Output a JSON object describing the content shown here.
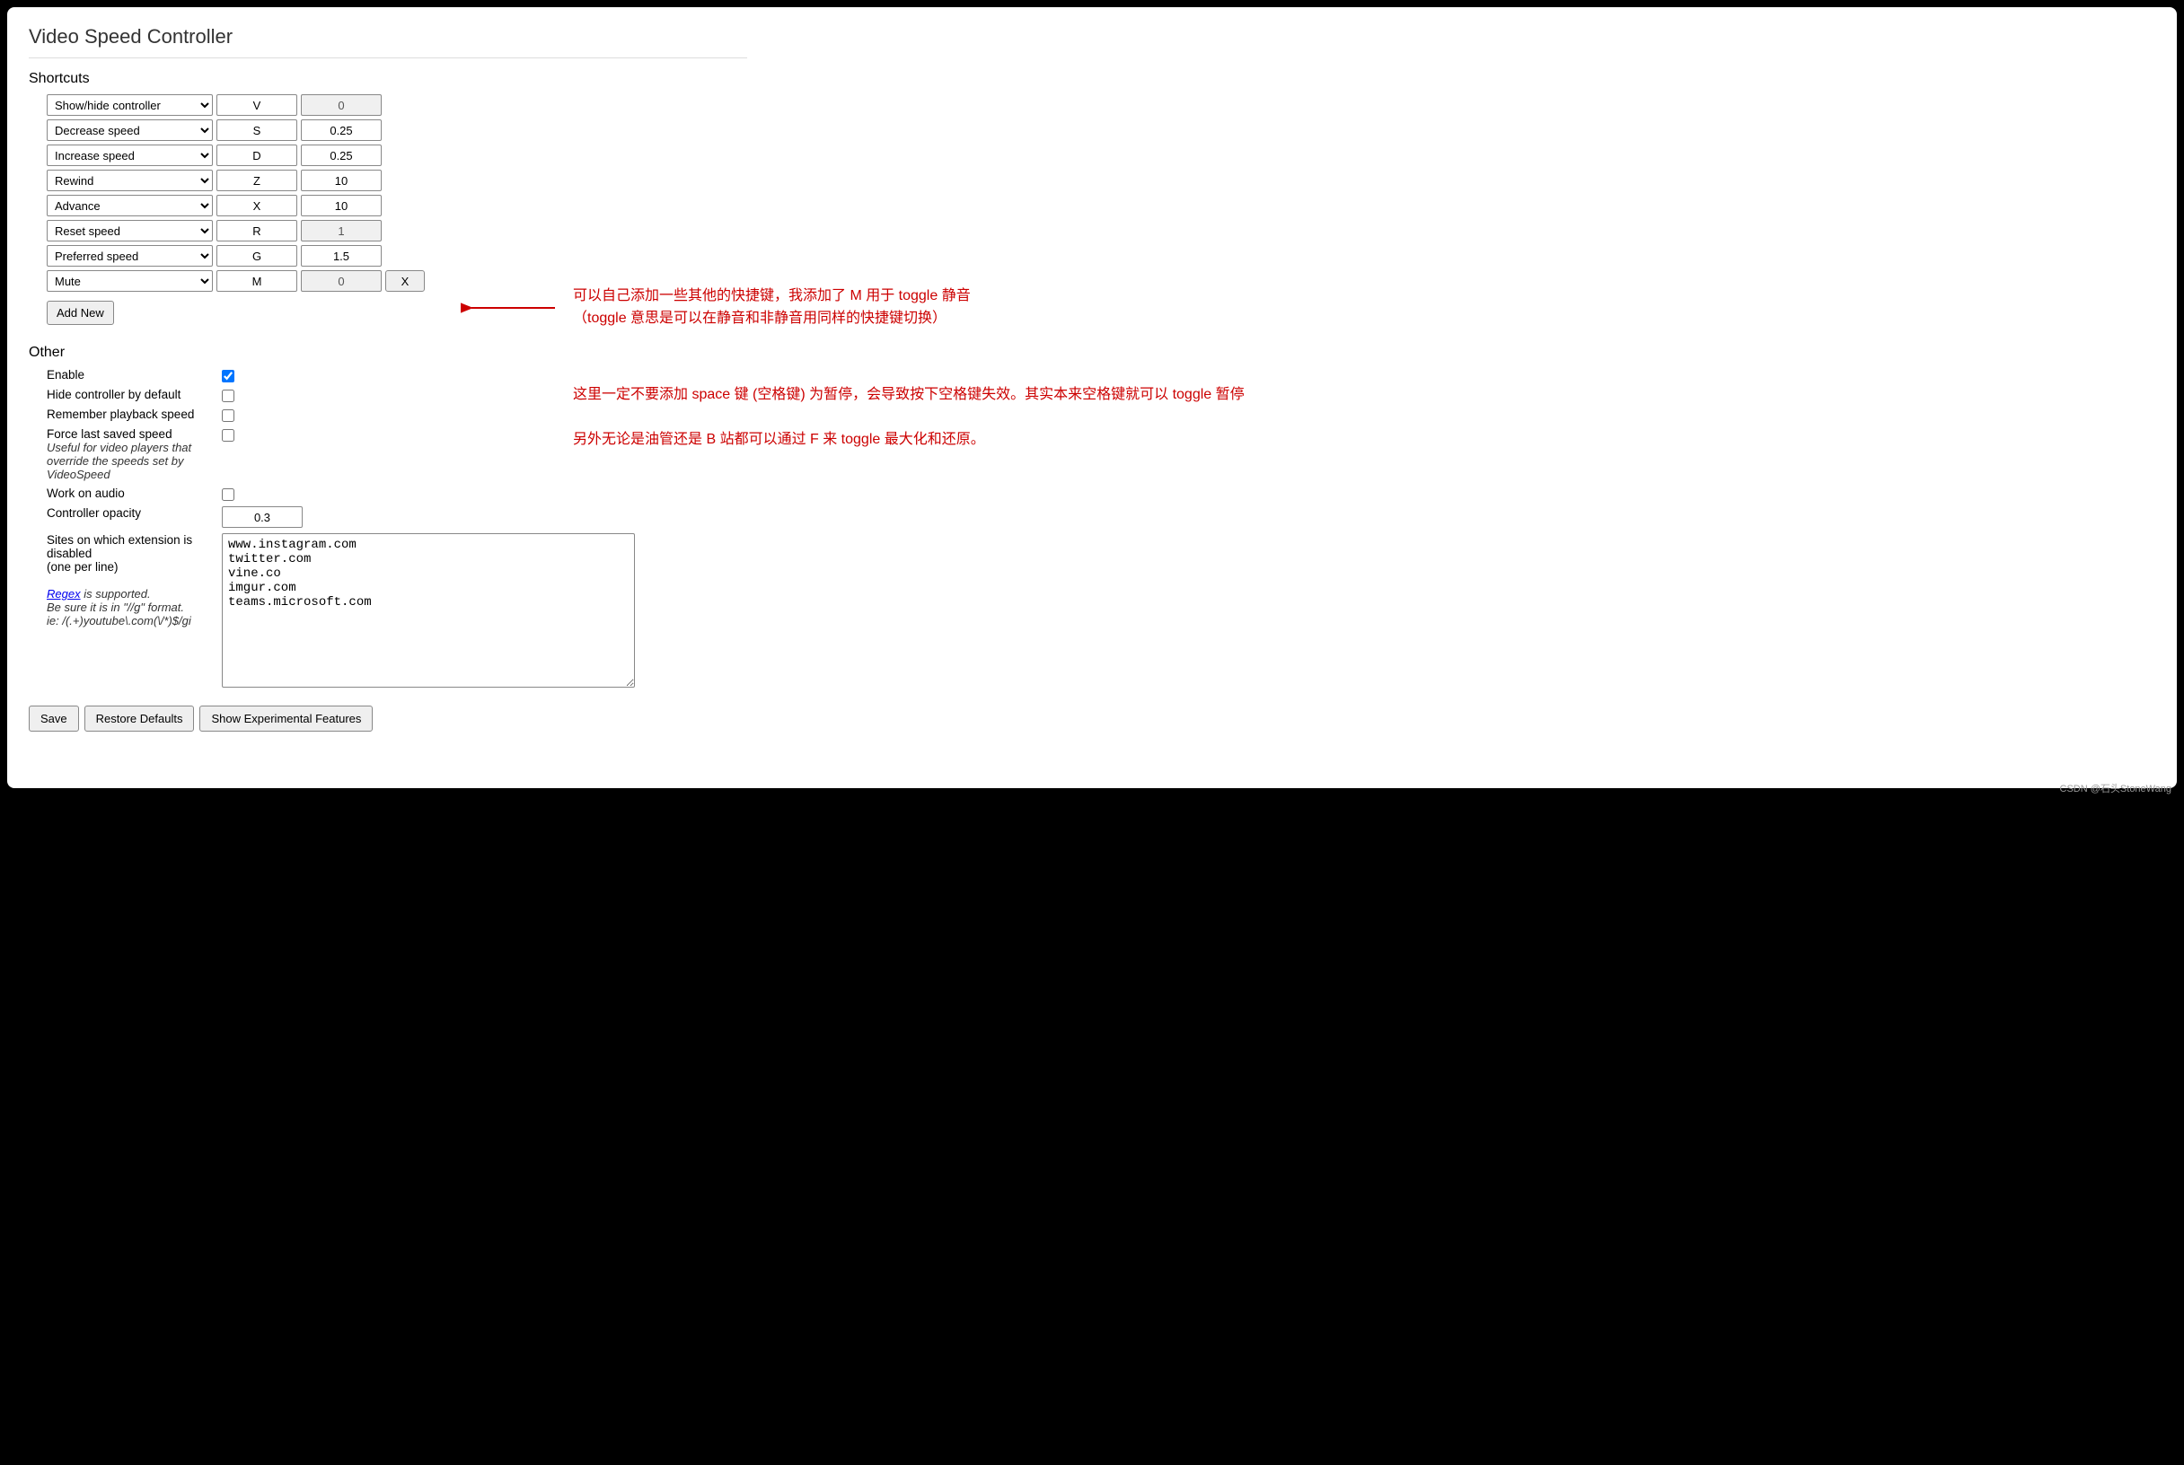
{
  "title": "Video Speed Controller",
  "sections": {
    "shortcuts_heading": "Shortcuts",
    "other_heading": "Other"
  },
  "shortcuts": [
    {
      "action": "Show/hide controller",
      "key": "V",
      "value": "0",
      "readonly": true,
      "removable": false
    },
    {
      "action": "Decrease speed",
      "key": "S",
      "value": "0.25",
      "readonly": false,
      "removable": false
    },
    {
      "action": "Increase speed",
      "key": "D",
      "value": "0.25",
      "readonly": false,
      "removable": false
    },
    {
      "action": "Rewind",
      "key": "Z",
      "value": "10",
      "readonly": false,
      "removable": false
    },
    {
      "action": "Advance",
      "key": "X",
      "value": "10",
      "readonly": false,
      "removable": false
    },
    {
      "action": "Reset speed",
      "key": "R",
      "value": "1",
      "readonly": true,
      "removable": false
    },
    {
      "action": "Preferred speed",
      "key": "G",
      "value": "1.5",
      "readonly": false,
      "removable": false
    },
    {
      "action": "Mute",
      "key": "M",
      "value": "0",
      "readonly": true,
      "removable": true
    }
  ],
  "buttons": {
    "add_new": "Add New",
    "remove": "X",
    "save": "Save",
    "restore": "Restore Defaults",
    "experimental": "Show Experimental Features"
  },
  "other": {
    "enable_label": "Enable",
    "enable_checked": true,
    "hide_label": "Hide controller by default",
    "hide_checked": false,
    "remember_label": "Remember playback speed",
    "remember_checked": false,
    "force_label": "Force last saved speed",
    "force_hint": "Useful for video players that override the speeds set by VideoSpeed",
    "force_checked": false,
    "audio_label": "Work on audio",
    "audio_checked": false,
    "opacity_label": "Controller opacity",
    "opacity_value": "0.3",
    "sites_label": "Sites on which extension is disabled",
    "sites_hint": "(one per line)",
    "regex_link": "Regex",
    "regex_hint1": " is supported.",
    "regex_hint2": "Be sure it is in \"//g\" format.",
    "regex_hint3": "ie: /(.+)youtube\\.com(\\/*)$/gi",
    "sites_value": "www.instagram.com\ntwitter.com\nvine.co\nimgur.com\nteams.microsoft.com"
  },
  "annotations": {
    "line1": "可以自己添加一些其他的快捷键，我添加了 M 用于 toggle 静音",
    "line2": "（toggle 意思是可以在静音和非静音用同样的快捷键切换）",
    "line3": "这里一定不要添加 space 键 (空格键) 为暂停，会导致按下空格键失效。其实本来空格键就可以 toggle 暂停",
    "line4": "另外无论是油管还是 B 站都可以通过 F 来 toggle 最大化和还原。"
  },
  "watermark": "CSDN @石头StoneWang"
}
